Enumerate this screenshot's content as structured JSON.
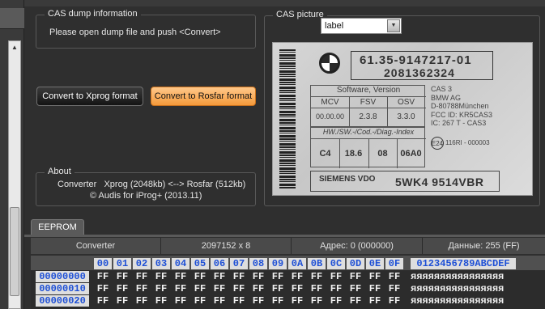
{
  "cas_dump": {
    "title": "CAS dump information",
    "message": "Please open dump file and push <Convert>"
  },
  "buttons": {
    "xprog": "Convert to Xprog format",
    "rosfar": "Convert to Rosfar format"
  },
  "about": {
    "title": "About",
    "line1": "Converter   Xprog (2048kb) <--> Rosfar (512kb)",
    "line2": "© Audis for iProg+ (2013.11)"
  },
  "cas_picture": {
    "title": "CAS picture",
    "dropdown_value": "label",
    "label": {
      "part_number": "61.35-9147217-01",
      "serial": "2081362324",
      "sw_title": "Software, Version",
      "sw_headers": [
        "MCV",
        "FSV",
        "OSV"
      ],
      "sw_values": [
        "00.00.00",
        "2.3.8",
        "3.3.0"
      ],
      "hw_title": "HW./SW.-/Cod.-/Diag.-Index",
      "hw_values": [
        "C4",
        "18.6",
        "08",
        "06A0"
      ],
      "info_lines": [
        "CAS 3",
        "BMW AG",
        "D-80788München",
        "FCC ID:  KR5CAS3",
        "IC: 267 T - CAS3"
      ],
      "e_mark": "E24",
      "e_number": "116RI - 000003",
      "brand": "SIEMENS VDO",
      "wk_number": "5WK4 9514VBR"
    }
  },
  "eeprom": {
    "tab_label": "EEPROM",
    "status": {
      "mode": "Converter",
      "size": "2097152 x 8",
      "address": "Адрес: 0 (000000)",
      "data": "Данные: 255 (FF)"
    },
    "hex_header": [
      "00",
      "01",
      "02",
      "03",
      "04",
      "05",
      "06",
      "07",
      "08",
      "09",
      "0A",
      "0B",
      "0C",
      "0D",
      "0E",
      "0F"
    ],
    "ascii_header": "0123456789ABCDEF",
    "rows": [
      {
        "addr": "00000000",
        "bytes": [
          "FF",
          "FF",
          "FF",
          "FF",
          "FF",
          "FF",
          "FF",
          "FF",
          "FF",
          "FF",
          "FF",
          "FF",
          "FF",
          "FF",
          "FF",
          "FF"
        ],
        "ascii": "яяяяяяяяяяяяяяяя"
      },
      {
        "addr": "00000010",
        "bytes": [
          "FF",
          "FF",
          "FF",
          "FF",
          "FF",
          "FF",
          "FF",
          "FF",
          "FF",
          "FF",
          "FF",
          "FF",
          "FF",
          "FF",
          "FF",
          "FF"
        ],
        "ascii": "яяяяяяяяяяяяяяяя"
      },
      {
        "addr": "00000020",
        "bytes": [
          "FF",
          "FF",
          "FF",
          "FF",
          "FF",
          "FF",
          "FF",
          "FF",
          "FF",
          "FF",
          "FF",
          "FF",
          "FF",
          "FF",
          "FF",
          "FF"
        ],
        "ascii": "яяяяяяяяяяяяяяяя"
      }
    ]
  }
}
